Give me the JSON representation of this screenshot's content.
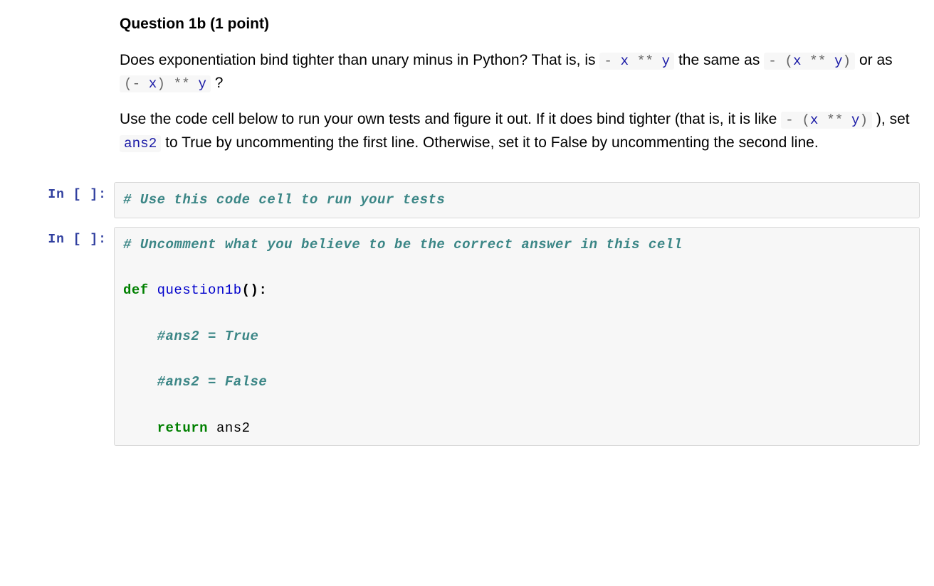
{
  "markdown": {
    "heading": "Question 1b (1 point)",
    "p1_a": "Does exponentiation bind tighter than unary minus in Python? That is, is ",
    "code1": "- x ** y",
    "p1_b": " the same as ",
    "code2": "- (x ** y)",
    "p1_c": " or as ",
    "code3": "(- x) ** y",
    "p1_d": " ?",
    "p2_a": "Use the code cell below to run your own tests and figure it out. If it does bind tighter (that is, it is like ",
    "code4": "- (x ** y)",
    "p2_b": " ), set ",
    "code5": "ans2",
    "p2_c": " to True by uncommenting the first line. Otherwise, set it to False by uncommenting the second line."
  },
  "cells": {
    "cell1": {
      "prompt": "In [ ]:",
      "code": "# Use this code cell to run your tests"
    },
    "cell2": {
      "prompt": "In [ ]:",
      "comment1": "# Uncomment what you believe to be the correct answer in this cell",
      "def_kw": "def",
      "def_name": "question1b",
      "def_parens": "():",
      "comment2": "#ans2 = True",
      "comment3": "#ans2 = False",
      "return_kw": "return",
      "return_ident": "ans2"
    }
  }
}
